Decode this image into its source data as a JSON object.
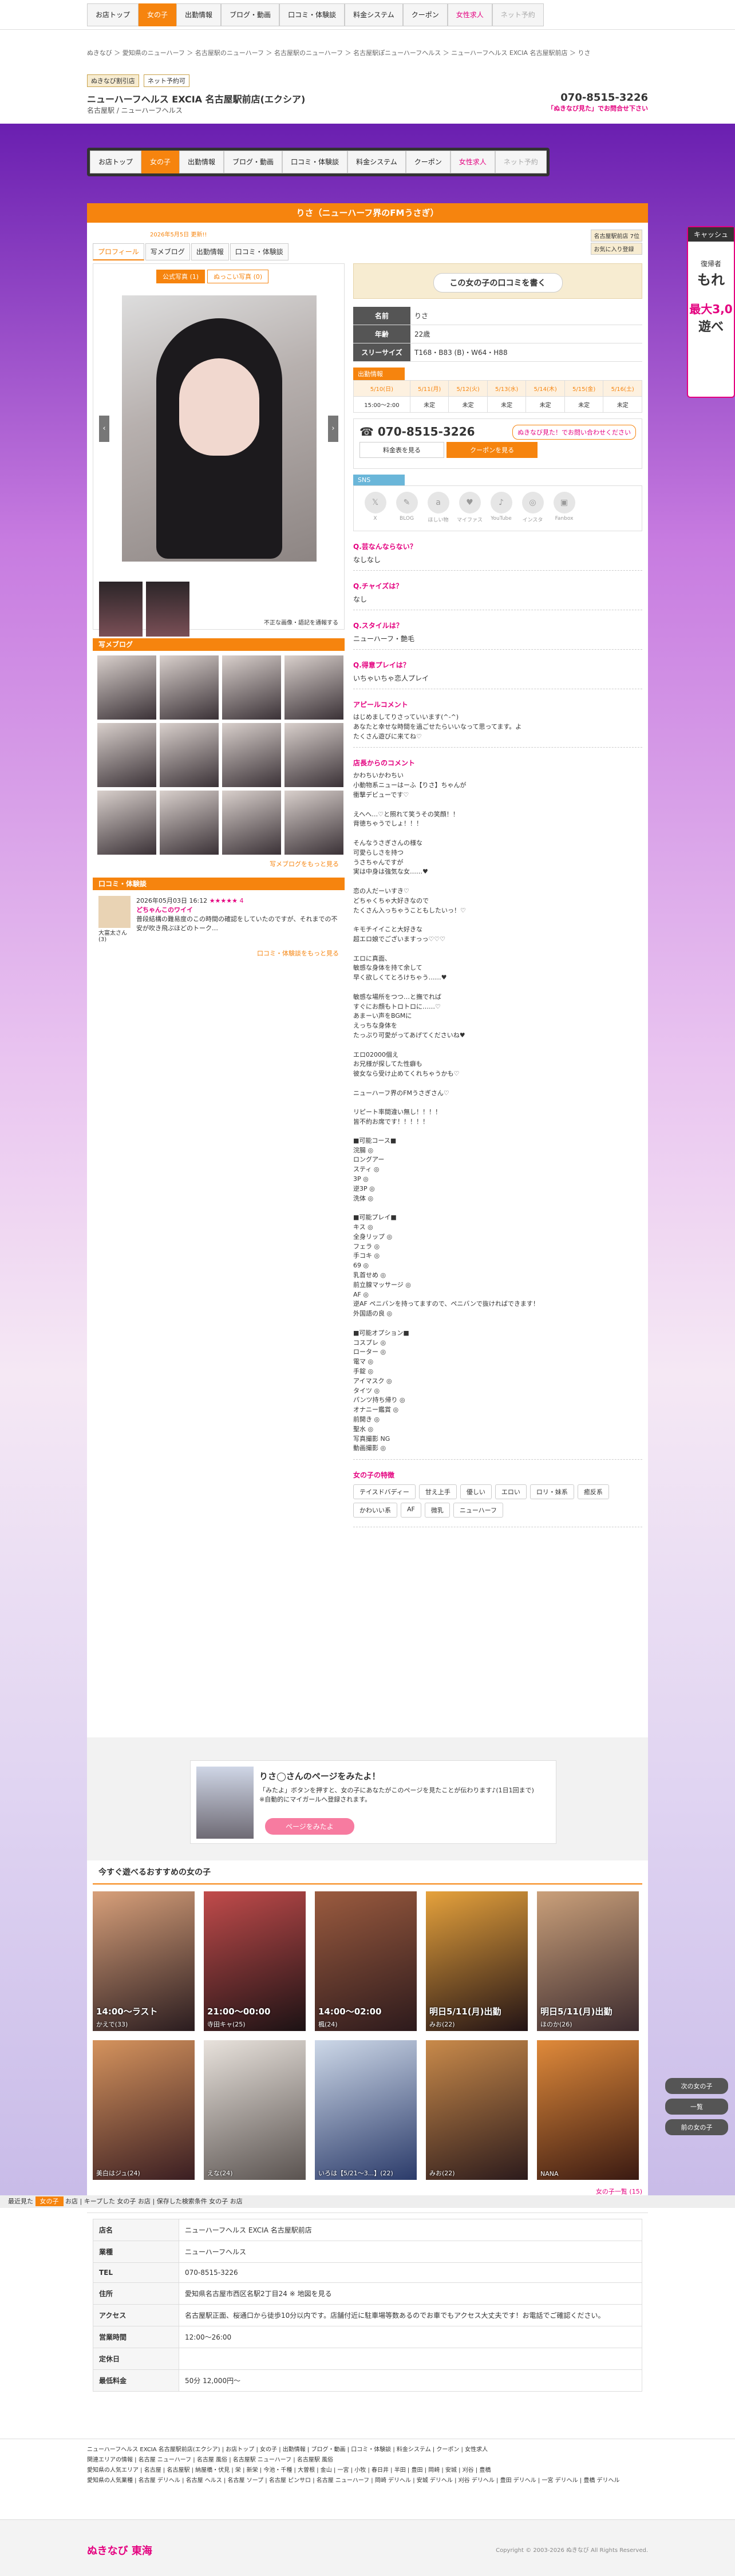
{
  "topnav": {
    "items": [
      {
        "label": "お店トップ"
      },
      {
        "label": "女の子"
      },
      {
        "label": "出勤情報"
      },
      {
        "label": "ブログ・動画"
      },
      {
        "label": "口コミ・体験談"
      },
      {
        "label": "料金システム"
      },
      {
        "label": "クーポン"
      },
      {
        "label": "女性求人"
      },
      {
        "label": "ネット予約"
      }
    ]
  },
  "crumbs": "ぬきなび ＞ 愛知県のニューハーフ ＞ 名古屋駅のニューハーフ ＞ 名古屋駅のニューハーフ ＞ 名古屋駅ぽニューハーフヘルス ＞ ニューハーフヘルス EXCIA 名古屋駅前店 ＞ りさ",
  "shop": {
    "tag1": "ぬきなび割引店",
    "tag2": "ネット予約可",
    "name": "ニューハーフヘルス EXCIA 名古屋駅前店(エクシア)",
    "sub": "名古屋駅 / ニューハーフヘルス",
    "tel": "070-8515-3226",
    "telsub": "「ぬきなび見た」でお問合せ下さい"
  },
  "girl": {
    "title": "りさ（ニューハーフ界のFMうさぎ）",
    "date": "2026年5月5日 更新!!",
    "tabs": [
      "プロフィール",
      "写メブログ",
      "出勤情報",
      "口コミ・体験談"
    ],
    "fav1": "名古屋駅前店 7位",
    "fav2": "お気に入り登録",
    "phototab1": "公式写真 (1)",
    "phototab2": "ぬっこい写真 (0)",
    "photonote": "不正な画像・語記を通報する",
    "review_button": "この女の子の口コミを書く",
    "name_label": "名前",
    "name": "りさ",
    "age_label": "年齢",
    "age": "22歳",
    "size_label": "スリーサイズ",
    "size": "T168・B83 (B)・W64・H88"
  },
  "schedule": {
    "title": "出勤情報",
    "days": [
      "5/10(日)",
      "5/11(月)",
      "5/12(火)",
      "5/13(水)",
      "5/14(木)",
      "5/15(金)",
      "5/16(土)"
    ],
    "times": [
      "15:00〜2:00",
      "未定",
      "未定",
      "未定",
      "未定",
      "未定",
      "未定"
    ]
  },
  "contact": {
    "tel": "070-8515-3226",
    "note": "ぬきなび見た！でお問い合わせください",
    "price": "料金表を見る",
    "coupon": "クーポンを見る"
  },
  "sns": {
    "title": "SNS",
    "items": [
      "X",
      "BLOG",
      "ほしい物",
      "マイファス",
      "YouTube",
      "インスタ",
      "Fanbox"
    ]
  },
  "qa": [
    {
      "q": "Q.芸なんならない？",
      "a": "なしなし"
    },
    {
      "q": "Q.チャイズは？",
      "a": "なし"
    },
    {
      "q": "Q.スタイルは？",
      "a": "ニューハーフ・艶毛"
    },
    {
      "q": "Q.得意プレイは？",
      "a": "いちゃいちゃ恋人プレイ"
    }
  ],
  "appeal": {
    "title": "アピールコメント",
    "text": "はじめましてりさっていいます(^-^)\nあなたと幸せな時間を過ごせたらいいなって思ってます。よ\nたくさん遊びに来てね♡"
  },
  "shopcomment": {
    "title": "店長からのコメント",
    "text": "かわちいかわちい\n小動物系ニューはーふ【りさ】ちゃんが\n衝撃デビューです♡\n\nえへへ…♡と照れて笑うその笑顔！！\n背徳ちゃうでしょ！！！\n\nそんなうさぎさんの様な\n可愛らしさを持つ\nうさちゃんですが\n実は中身は強気な女……♥\n\n恋の人だーいすき♡\nどちゃくちゃ大好きなので\nたくさん入っちゃうこともしたいっ！♡\n\nキモチイイこと大好きな\n超エロ娘でございますっっ♡♡♡\n\nエロに真面、\n敏感な身体を持て余して\n早く欲しくてとろけちゃう……♥\n\n敏感な場所をつつ…と撫でれば\nすぐにお顔もトロトロに……♡\nあまーい声をBGMに\nえっちな身体を\nたっぷり可愛がってあげてくださいね♥\n\nエロ02000個え\nお兄様が探してた性癖も\n彼女なら受け止めてくれちゃうかも♡\n\nニューハーフ界のFMうさぎさん♡\n\nリピート率間違い無し！！！！\n皆不約お席です！！！！！"
  },
  "options": {
    "text": "■可能コース■\n浣腸 ◎\nロングアー\nスティ ◎\n3P ◎\n逆3P ◎\n洗体 ◎\n\n■可能プレイ■\nキス ◎\n全身リップ ◎\nフェラ ◎\n手コキ ◎\n69 ◎\n乳首せめ ◎\n前立腺マッサージ ◎\nAF ◎\n逆AF ペニバンを持ってますので、ペニバンで抜ければできます！\n外国語の良 ◎\n\n■可能オプション■\nコスプレ ◎\nローター ◎\n電マ ◎\n手錠 ◎\nアイマスク ◎\nタイツ ◎\nパンツ持ち帰り ◎\nオナニー鑑賞 ◎\n前開き ◎\n聖水 ◎\n写真撮影 NG\n動画撮影 ◎"
  },
  "tags": {
    "title": "女の子の特徴",
    "items": [
      "テイスドバディー",
      "甘え上手",
      "優しい",
      "エロい",
      "ロリ・妹系",
      "癒反系",
      "かわいい系",
      "AF",
      "微乳",
      "ニューハーフ"
    ]
  },
  "blog": {
    "title": "写メブログ",
    "more": "写メブログをもっと見る"
  },
  "review": {
    "title": "口コミ・体験談",
    "date": "2026年05月03日 16:12",
    "score": "★★★★★ 4",
    "headline": "どちゃんこのワイイ",
    "body": "普段結構の難易度のこの時間の確認をしていたのですが、それまでの不安が吹き飛ぶほどのトーク…",
    "user": "大富太さん (3)",
    "more": "口コミ・体験談をもっと見る"
  },
  "promo": {
    "title": "りさ◯さんのページをみたよ！",
    "text": "「みたよ」ボタンを押すと、女の子にあなたがこのページを見たことが伝わります♪(1日1回まで) ※自動的にマイガールへ登録されます。",
    "button": "ページをみたよ"
  },
  "rec": {
    "title": "今すぐ遊べるおすすめの女の子",
    "items": [
      {
        "badge": "14:00〜ラスト",
        "name": "かえで(33)"
      },
      {
        "badge": "21:00〜00:00",
        "name": "寺田キャ(25)"
      },
      {
        "badge": "14:00〜02:00",
        "name": "楓(24)"
      },
      {
        "badge": "明日5/11(月)出勤",
        "name": "みお(22)"
      },
      {
        "badge": "明日5/11(月)出勤",
        "name": "ほのか(26)"
      },
      {
        "badge": "",
        "name": "美白はジュ(24)"
      },
      {
        "badge": "",
        "name": "えな(24)"
      },
      {
        "badge": "",
        "name": "いろは【5/21〜3...】(22)"
      },
      {
        "badge": "",
        "name": "みお(22)"
      },
      {
        "badge": "",
        "name": "NANA"
      }
    ],
    "more": "女の子一覧 (15)"
  },
  "bottombar": {
    "label1": "最近見た",
    "label2": "女の子",
    "label3": "お店",
    "label4": "キープした",
    "label5": "女の子",
    "label6": "お店",
    "label7": "保存した検索条件",
    "label8": "女の子",
    "label9": "お店"
  },
  "shopinfo": [
    {
      "h": "店名",
      "v": "ニューハーフヘルス EXCIA 名古屋駅前店"
    },
    {
      "h": "業種",
      "v": "ニューハーフヘルス"
    },
    {
      "h": "TEL",
      "v": "070-8515-3226"
    },
    {
      "h": "住所",
      "v": "愛知県名古屋市西区名駅2丁目24 ※ 地図を見る"
    },
    {
      "h": "アクセス",
      "v": "名古屋駅正面、桜通口から徒歩10分以内です。店舗付近に駐車場等数あるのでお車でもアクセス大丈夫です！お電話でご確認ください。"
    },
    {
      "h": "営業時間",
      "v": "12:00〜26:00"
    },
    {
      "h": "定休日",
      "v": ""
    },
    {
      "h": "最低料金",
      "v": "50分 12,000円〜"
    }
  ],
  "sidead": {
    "title": "キャッシュ",
    "line1": "復帰者",
    "line2": "もれ",
    "line3": "最大3,0",
    "line4": "遊べ"
  },
  "sidebtns": [
    "次の女の子",
    "一覧",
    "前の女の子"
  ],
  "footer": {
    "line1": "ニューハーフヘルス EXCIA 名古屋駅前店(エクシア) | お店トップ | 女の子 | 出勤情報 | ブログ・動画 | 口コミ・体験談 | 料金システム | クーポン | 女性求人",
    "line2": "関連エリアの情報 | 名古屋 ニューハーフ | 名古屋 風俗 | 名古屋駅 ニューハーフ | 名古屋駅 風俗",
    "line3": "愛知県の人気エリア | 名古屋 | 名古屋駅 | 納屋橋・伏見 | 栄 | 新栄 | 今池・千種 | 大曽根 | 金山 | 一宮 | 小牧 | 春日井 | 半田 | 豊田 | 岡崎 | 安城 | 刈谷 | 豊橋",
    "line4": "愛知県の人気業種 | 名古屋 デリヘル | 名古屋 ヘルス | 名古屋 ソープ | 名古屋 ピンサロ | 名古屋 ニューハーフ | 岡崎 デリヘル | 安城 デリヘル | 刈谷 デリヘル | 豊田 デリヘル | 一宮 デリヘル | 豊橋 デリヘル",
    "logo": "ぬきなび 東海",
    "copy": "Copyright © 2003-2026 ぬきなび All Rights Reserved."
  }
}
